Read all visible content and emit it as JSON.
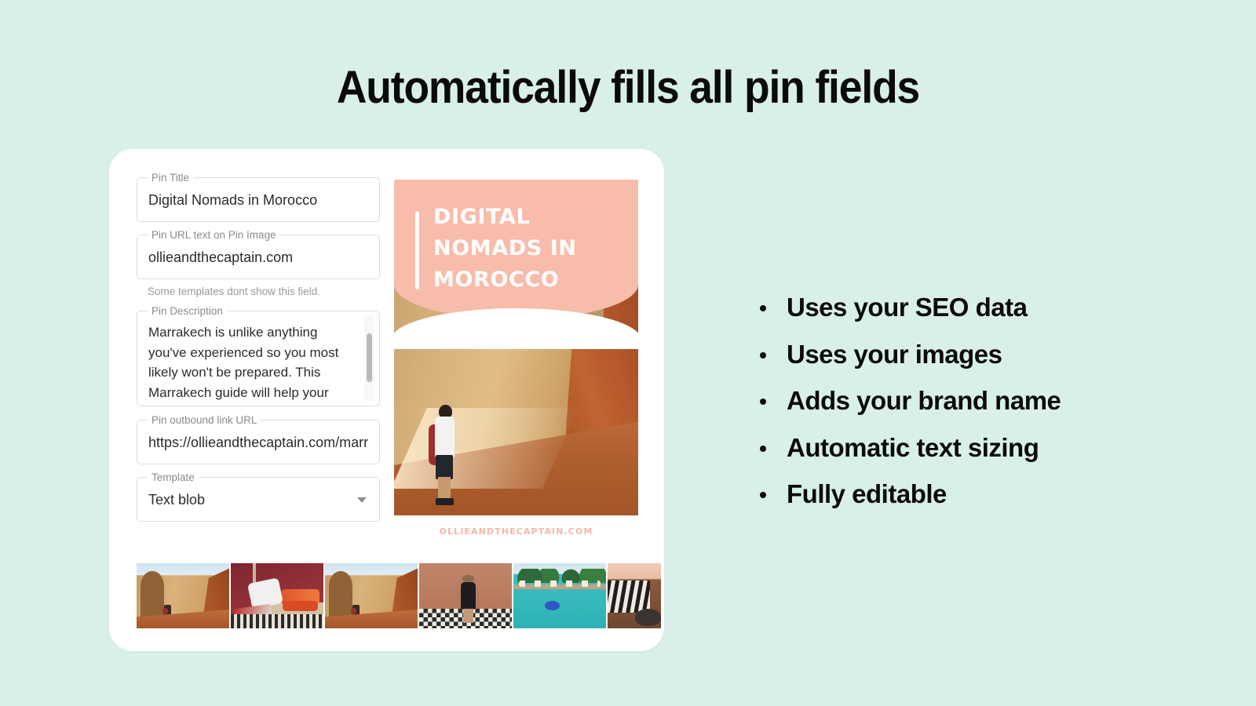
{
  "headline": "Automatically fills all pin fields",
  "theme": {
    "background": "#d9f0ea",
    "card_background": "#ffffff",
    "pin_accent": "#f8bcab",
    "text": "#0b0b0b",
    "label": "#8a8a8a"
  },
  "form": {
    "fields": [
      {
        "name": "pin-title",
        "label": "Pin Title",
        "value": "Digital Nomads in Morocco",
        "placeholder": "Pin Title"
      },
      {
        "name": "pin-url-text",
        "label": "Pin URL text on Pin Image",
        "value": "ollieandthecaptain.com",
        "placeholder": "Pin URL text on Pin Image",
        "helper": "Some templates dont show this field."
      },
      {
        "name": "pin-description",
        "label": "Pin Description",
        "value": "Marrakech is unlike anything you've experienced so you most likely won't be prepared. This Marrakech guide will help your",
        "placeholder": "Pin Description"
      },
      {
        "name": "pin-outbound-link",
        "label": "Pin outbound link URL",
        "value": "https://ollieandthecaptain.com/marr",
        "placeholder": "Pin outbound link URL"
      },
      {
        "name": "template",
        "label": "Template",
        "value": "Text blob",
        "placeholder": "Template",
        "options": [
          "Text blob"
        ]
      }
    ]
  },
  "pin_preview": {
    "overlay_title": "Digital Nomads in Morocco",
    "footer_url": "ollieandthecaptain.com",
    "image_alt": "Traveler with red backpack photographing a tall sandstone wall in Marrakech"
  },
  "thumbnails": [
    {
      "name": "thumb-alley-1",
      "alt": "Sandstone alley with traveler"
    },
    {
      "name": "thumb-riad",
      "alt": "Riad interior with red cushions"
    },
    {
      "name": "thumb-alley-2",
      "alt": "Sandstone alley with traveler"
    },
    {
      "name": "thumb-woman-tiles",
      "alt": "Woman standing on patterned tile floor"
    },
    {
      "name": "thumb-pool",
      "alt": "Hotel pool with blue float"
    },
    {
      "name": "thumb-market",
      "alt": "Market stall with striped textiles"
    }
  ],
  "features": [
    "Uses your SEO data",
    "Uses your images",
    "Adds your brand name",
    "Automatic text sizing",
    "Fully editable"
  ]
}
